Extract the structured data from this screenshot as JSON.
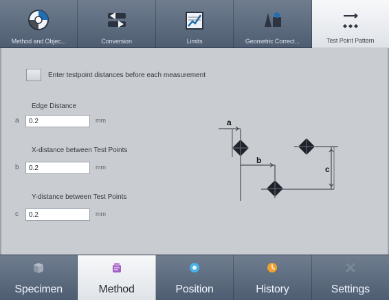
{
  "top_tabs": {
    "items": [
      {
        "label": "Method and Objec...",
        "icon": "method-objectives-icon"
      },
      {
        "label": "Conversion",
        "icon": "conversion-icon"
      },
      {
        "label": "Limits",
        "icon": "limits-icon"
      },
      {
        "label": "Geometric Correct...",
        "icon": "geometric-correction-icon"
      },
      {
        "label": "Test Point Pattern",
        "icon": "test-point-pattern-icon",
        "active": true
      }
    ]
  },
  "panel": {
    "checkbox_label": "Enter testpoint distances before each measurement",
    "fields": [
      {
        "letter": "a",
        "label": "Edge Distance",
        "value": "0.2",
        "unit": "mm"
      },
      {
        "letter": "b",
        "label": "X-distance between Test Points",
        "value": "0.2",
        "unit": "mm"
      },
      {
        "letter": "c",
        "label": "Y-distance between Test Points",
        "value": "0.2",
        "unit": "mm"
      }
    ],
    "diagram_labels": {
      "a": "a",
      "b": "b",
      "c": "c"
    }
  },
  "bottom_nav": {
    "items": [
      {
        "label": "Specimen",
        "icon": "specimen-icon",
        "color": "#9aa4b1"
      },
      {
        "label": "Method",
        "icon": "method-icon",
        "active": true,
        "color": "#a55fc4"
      },
      {
        "label": "Position",
        "icon": "position-icon",
        "color": "#4ab0e8"
      },
      {
        "label": "History",
        "icon": "history-icon",
        "color": "#f0a030"
      },
      {
        "label": "Settings",
        "icon": "settings-icon",
        "color": "#7a8797"
      }
    ]
  }
}
